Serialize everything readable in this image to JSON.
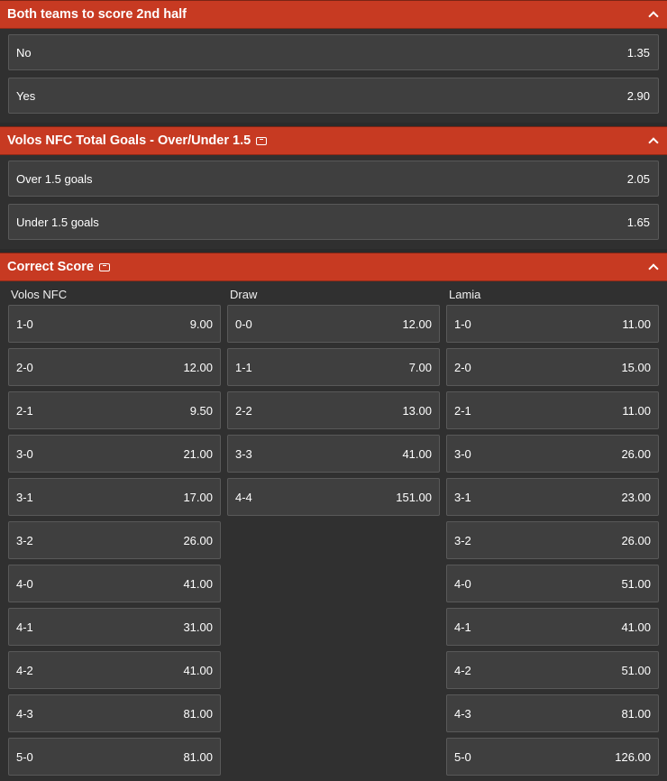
{
  "markets": [
    {
      "title": "Both teams to score 2nd half",
      "has_bet_builder_icon": false,
      "selections": [
        {
          "label": "No",
          "odds": "1.35"
        },
        {
          "label": "Yes",
          "odds": "2.90"
        }
      ]
    },
    {
      "title": "Volos NFC Total Goals - Over/Under 1.5",
      "has_bet_builder_icon": true,
      "selections": [
        {
          "label": "Over 1.5 goals",
          "odds": "2.05"
        },
        {
          "label": "Under 1.5 goals",
          "odds": "1.65"
        }
      ]
    }
  ],
  "correct_score": {
    "title": "Correct Score",
    "columns": [
      {
        "label": "Volos NFC",
        "rows": [
          {
            "score": "1-0",
            "odds": "9.00"
          },
          {
            "score": "2-0",
            "odds": "12.00"
          },
          {
            "score": "2-1",
            "odds": "9.50"
          },
          {
            "score": "3-0",
            "odds": "21.00"
          },
          {
            "score": "3-1",
            "odds": "17.00"
          },
          {
            "score": "3-2",
            "odds": "26.00"
          },
          {
            "score": "4-0",
            "odds": "41.00"
          },
          {
            "score": "4-1",
            "odds": "31.00"
          },
          {
            "score": "4-2",
            "odds": "41.00"
          },
          {
            "score": "4-3",
            "odds": "81.00"
          },
          {
            "score": "5-0",
            "odds": "81.00"
          }
        ]
      },
      {
        "label": "Draw",
        "rows": [
          {
            "score": "0-0",
            "odds": "12.00"
          },
          {
            "score": "1-1",
            "odds": "7.00"
          },
          {
            "score": "2-2",
            "odds": "13.00"
          },
          {
            "score": "3-3",
            "odds": "41.00"
          },
          {
            "score": "4-4",
            "odds": "151.00"
          }
        ]
      },
      {
        "label": "Lamia",
        "rows": [
          {
            "score": "1-0",
            "odds": "11.00"
          },
          {
            "score": "2-0",
            "odds": "15.00"
          },
          {
            "score": "2-1",
            "odds": "11.00"
          },
          {
            "score": "3-0",
            "odds": "26.00"
          },
          {
            "score": "3-1",
            "odds": "23.00"
          },
          {
            "score": "3-2",
            "odds": "26.00"
          },
          {
            "score": "4-0",
            "odds": "51.00"
          },
          {
            "score": "4-1",
            "odds": "41.00"
          },
          {
            "score": "4-2",
            "odds": "51.00"
          },
          {
            "score": "4-3",
            "odds": "81.00"
          },
          {
            "score": "5-0",
            "odds": "126.00"
          }
        ]
      }
    ]
  },
  "icons": {
    "collapse": "chevron-up-icon",
    "bet_builder": "bet-builder-icon"
  },
  "colors": {
    "header": "#c73a22",
    "row": "#3f3f3f",
    "background": "#2b2b2b"
  }
}
